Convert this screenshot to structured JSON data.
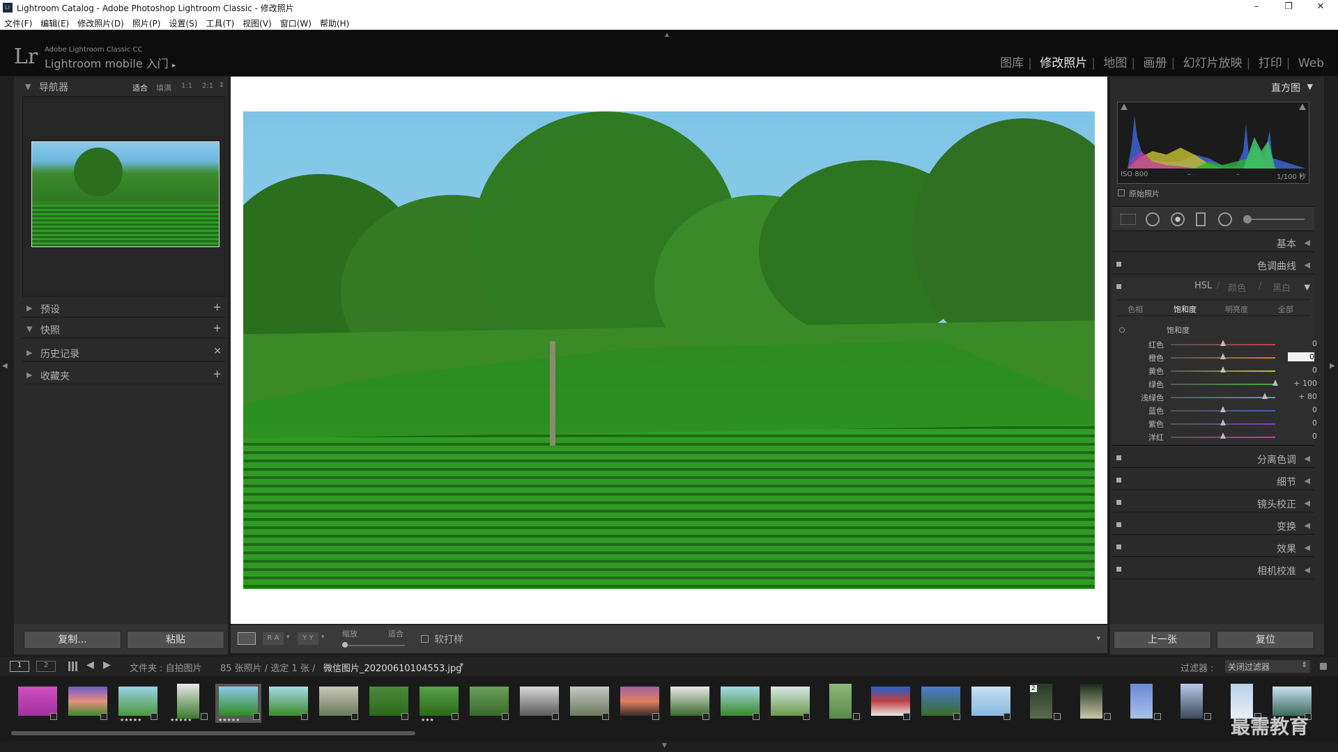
{
  "window": {
    "title": "Lightroom Catalog - Adobe Photoshop Lightroom Classic - 修改照片",
    "logo": "Lr",
    "controls": [
      "–",
      "❐",
      "✕"
    ]
  },
  "menu": [
    "文件(F)",
    "编辑(E)",
    "修改照片(D)",
    "照片(P)",
    "设置(S)",
    "工具(T)",
    "视图(V)",
    "窗口(W)",
    "帮助(H)"
  ],
  "identity": {
    "logo": "Lr",
    "small": "Adobe Lightroom Classic CC",
    "big": "Lightroom mobile 入门",
    "arrow": "▸"
  },
  "modules": [
    "图库",
    "修改照片",
    "地图",
    "画册",
    "幻灯片放映",
    "打印",
    "Web"
  ],
  "module_sep": "|",
  "active_module": "修改照片",
  "left": {
    "navigator": {
      "title": "导航器",
      "zoom": [
        "适合",
        "填满",
        "1:1",
        "2:1"
      ],
      "zoom_arrow": "⇕"
    },
    "sections": [
      {
        "title": "预设",
        "action": "+"
      },
      {
        "title": "快照",
        "action": "+"
      },
      {
        "title": "历史记录",
        "action": "×"
      },
      {
        "title": "收藏夹",
        "action": "+"
      }
    ],
    "copy_btn": "复制...",
    "paste_btn": "粘贴"
  },
  "toolbar": {
    "compare1": "R A",
    "compare2": "Y Y",
    "zoom_label": "缩放",
    "zoom_value": "适合",
    "softproof": "软打样",
    "menu_arrow": "▾"
  },
  "right": {
    "histogram": {
      "title": "直方图",
      "iso": "ISO 800",
      "dash1": "–",
      "dash2": "–",
      "shutter": "1/100 秒",
      "original": "原始照片"
    },
    "collapsed_top": [
      "基本",
      "色调曲线"
    ],
    "hsl": {
      "tabs": [
        "HSL",
        "颜色",
        "黑白"
      ],
      "subtabs": [
        "色相",
        "饱和度",
        "明亮度",
        "全部"
      ],
      "active_subtab": "饱和度",
      "group": "饱和度",
      "sliders": [
        {
          "label": "红色",
          "value": "0",
          "pos": 0.5,
          "color": "#c84040"
        },
        {
          "label": "橙色",
          "value": "0",
          "pos": 0.5,
          "color": "#d08030"
        },
        {
          "label": "黄色",
          "value": "0",
          "pos": 0.5,
          "color": "#c8c040"
        },
        {
          "label": "绿色",
          "value": "+ 100",
          "pos": 1.0,
          "color": "#40b040"
        },
        {
          "label": "浅绿色",
          "value": "+ 80",
          "pos": 0.9,
          "color": "#40b0b0"
        },
        {
          "label": "蓝色",
          "value": "0",
          "pos": 0.5,
          "color": "#4060c8"
        },
        {
          "label": "紫色",
          "value": "0",
          "pos": 0.5,
          "color": "#8040c0"
        },
        {
          "label": "洋红",
          "value": "0",
          "pos": 0.5,
          "color": "#c040a0"
        }
      ]
    },
    "collapsed_bottom": [
      "分离色调",
      "细节",
      "镜头校正",
      "变换",
      "效果",
      "相机校准"
    ],
    "prev_btn": "上一张",
    "reset_btn": "复位"
  },
  "filmstrip_bar": {
    "view1": "1",
    "view2": "2",
    "path": "文件夹 : 自拍图片",
    "count": "85 张照片 / 选定 1 张 /",
    "filename": "微信图片_20200610104553.jpg",
    "filename_arrow": "▾",
    "filter_label": "过滤器 :",
    "filter_value": "关闭过滤器",
    "filter_arrow": "⇕"
  },
  "thumb_labels": {
    "stars5": "★★★★★",
    "stars3": "★★★",
    "badge2": "2"
  },
  "watermark": "最需教育"
}
